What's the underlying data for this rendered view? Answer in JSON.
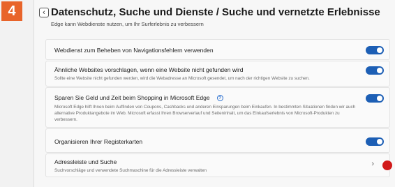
{
  "step_badge": "4",
  "header": {
    "title": "Datenschutz, Suche und Dienste / Suche und vernetzte Erlebnisse",
    "subtitle": "Edge kann Webdienste nutzen, um Ihr Surferlebnis zu verbessern"
  },
  "settings": [
    {
      "title": "Webdienst zum Beheben von Navigationsfehlern verwenden",
      "toggle_on": true
    },
    {
      "title": "Ähnliche Websites vorschlagen, wenn eine Website nicht gefunden wird",
      "description": "Sollte eine Website nicht gefunden werden, wird die Webadresse an Microsoft gesendet, um nach der richtigen Website zu suchen.",
      "toggle_on": true
    },
    {
      "title": "Sparen Sie Geld und Zeit beim Shopping in Microsoft Edge",
      "description": "Microsoft Edge hilft Ihnen beim Auffinden von Coupons, Cashbacks und anderen Einsparungen beim Einkaufen. In bestimmten Situationen finden wir auch alternative Produktangebote im Web. Microsoft erfasst Ihren Browserverlauf und Seiteninhalt, um das Einkaufserlebnis von Microsoft-Produkten zu verbessern.",
      "toggle_on": true,
      "icon": "info-icon"
    },
    {
      "title": "Organisieren Ihrer Registerkarten",
      "toggle_on": true
    },
    {
      "title": "Adressleiste und Suche",
      "description": "Suchvorschläge und verwendete Suchmaschine für die Adressleiste verwalten",
      "icon": "chevron-right-icon"
    }
  ],
  "colors": {
    "accent": "#1d5fb5",
    "badge": "#e8642a",
    "marker": "#d11a1a"
  }
}
